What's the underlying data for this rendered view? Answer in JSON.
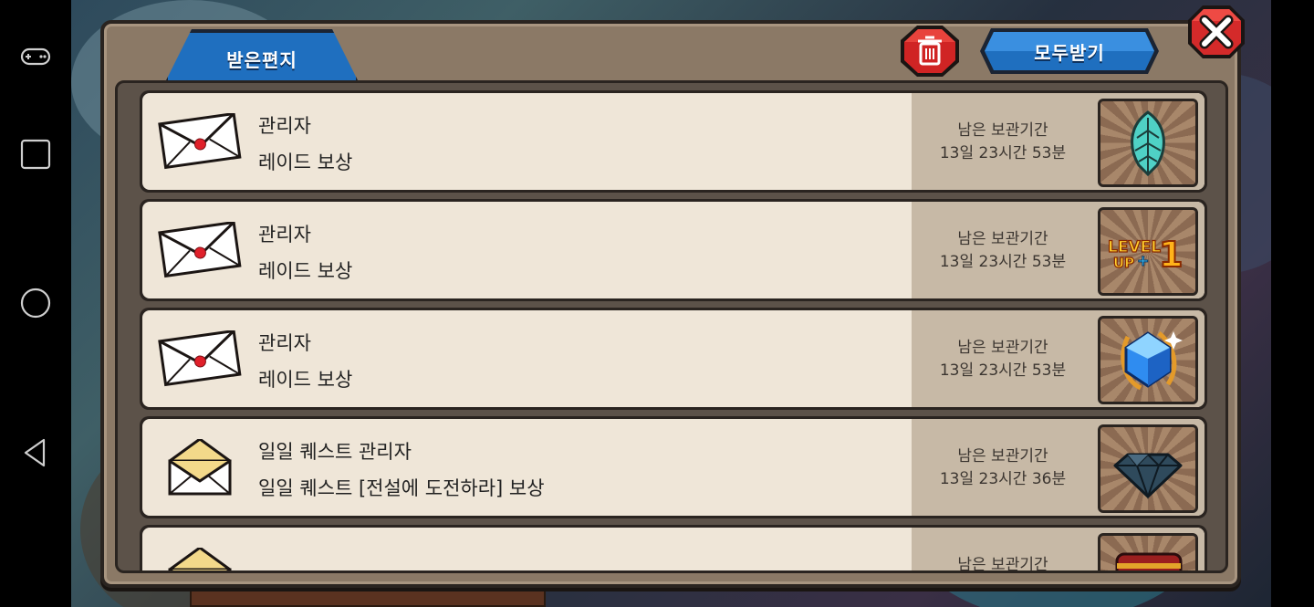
{
  "tabs": {
    "inbox": "받은편지"
  },
  "toolbar": {
    "receive_all": "모두받기"
  },
  "mails": [
    {
      "sender": "관리자",
      "subject": "레이드 보상",
      "retention_label": "남은 보관기간",
      "retention_time": "13일 23시간 53분",
      "item_icon": "feather-icon",
      "envelope": "sealed"
    },
    {
      "sender": "관리자",
      "subject": "레이드 보상",
      "retention_label": "남은 보관기간",
      "retention_time": "13일 23시간 53분",
      "item_icon": "level-up-icon",
      "envelope": "sealed"
    },
    {
      "sender": "관리자",
      "subject": "레이드 보상",
      "retention_label": "남은 보관기간",
      "retention_time": "13일 23시간 53분",
      "item_icon": "blue-gem-icon",
      "envelope": "sealed"
    },
    {
      "sender": "일일 퀘스트 관리자",
      "subject": "일일 퀘스트 [전설에 도전하라] 보상",
      "retention_label": "남은 보관기간",
      "retention_time": "13일 23시간 36분",
      "item_icon": "diamond-icon",
      "envelope": "open"
    },
    {
      "sender": "",
      "subject": "",
      "retention_label": "남은 보관기간",
      "retention_time": "",
      "item_icon": "treasure-chest-icon",
      "envelope": "open"
    }
  ],
  "colors": {
    "tab_blue": "#1f6fbf",
    "close_red": "#d42a2a",
    "seal_red": "#e0202a",
    "open_envelope": "#f3d98a"
  }
}
